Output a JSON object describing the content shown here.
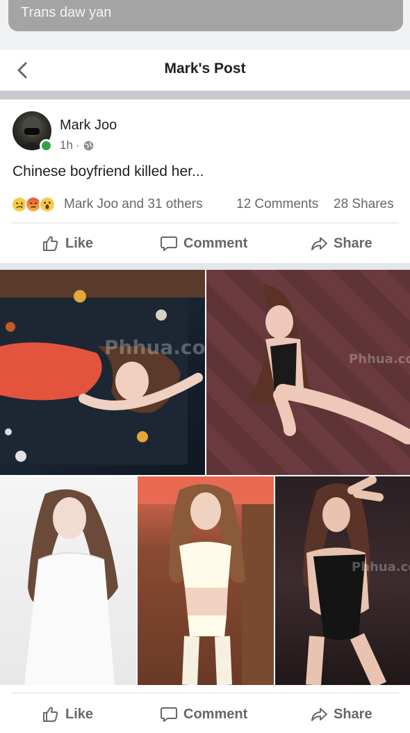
{
  "search_field": {
    "text": "Trans daw yan"
  },
  "header": {
    "title": "Mark's Post",
    "back_icon": "chevron-left-icon"
  },
  "post": {
    "author": "Mark Joo",
    "time": "1h",
    "separator": "·",
    "privacy_icon": "globe-icon",
    "online": true,
    "text": "Chinese boyfriend killed her...",
    "reactions": {
      "icons": [
        "sad-reaction",
        "angry-reaction",
        "wow-reaction"
      ],
      "names": "Mark Joo and 31 others",
      "comments": "12 Comments",
      "shares": "28 Shares"
    },
    "actions": {
      "like": "Like",
      "comment": "Comment",
      "share": "Share"
    },
    "photo_count": 5,
    "watermark": "Phhua.com"
  },
  "colors": {
    "secondary_text": "#65676b",
    "divider": "#dadde1",
    "online": "#31a24c"
  }
}
